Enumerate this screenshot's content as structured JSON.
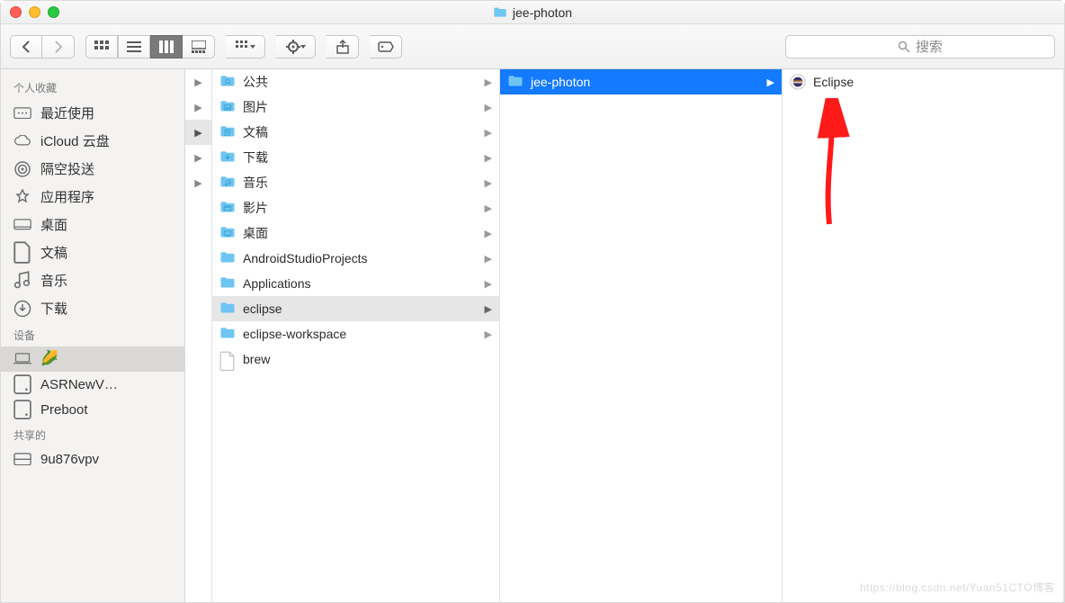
{
  "window": {
    "title": "jee-photon"
  },
  "search": {
    "placeholder": "搜索"
  },
  "sidebar": {
    "sections": [
      {
        "header": "个人收藏",
        "items": [
          {
            "label": "最近使用",
            "icon": "recents"
          },
          {
            "label": "iCloud 云盘",
            "icon": "cloud"
          },
          {
            "label": "隔空投送",
            "icon": "airdrop"
          },
          {
            "label": "应用程序",
            "icon": "apps"
          },
          {
            "label": "桌面",
            "icon": "desktop"
          },
          {
            "label": "文稿",
            "icon": "documents"
          },
          {
            "label": "音乐",
            "icon": "music"
          },
          {
            "label": "下载",
            "icon": "downloads"
          }
        ]
      },
      {
        "header": "设备",
        "items": [
          {
            "label": "🌽",
            "icon": "laptop",
            "selected": true,
            "emoji": true
          },
          {
            "label": "ASRNewV…",
            "icon": "disk"
          },
          {
            "label": "Preboot",
            "icon": "disk"
          }
        ]
      },
      {
        "header": "共享的",
        "items": [
          {
            "label": "9u876vpv",
            "icon": "server"
          }
        ]
      }
    ]
  },
  "column0": {
    "rows": [
      "",
      "",
      "sel",
      "",
      ""
    ]
  },
  "column1": {
    "items": [
      {
        "label": "公共",
        "type": "folder-public",
        "hasChildren": true
      },
      {
        "label": "图片",
        "type": "folder-pictures",
        "hasChildren": true
      },
      {
        "label": "文稿",
        "type": "folder-documents",
        "hasChildren": true
      },
      {
        "label": "下载",
        "type": "folder-downloads",
        "hasChildren": true
      },
      {
        "label": "音乐",
        "type": "folder-music",
        "hasChildren": true
      },
      {
        "label": "影片",
        "type": "folder-movies",
        "hasChildren": true
      },
      {
        "label": "桌面",
        "type": "folder-desktop",
        "hasChildren": true
      },
      {
        "label": "AndroidStudioProjects",
        "type": "folder",
        "hasChildren": true
      },
      {
        "label": "Applications",
        "type": "folder",
        "hasChildren": true
      },
      {
        "label": "eclipse",
        "type": "folder",
        "hasChildren": true,
        "selected": "grey"
      },
      {
        "label": "eclipse-workspace",
        "type": "folder",
        "hasChildren": true
      },
      {
        "label": "brew",
        "type": "file",
        "hasChildren": false
      }
    ]
  },
  "column2": {
    "items": [
      {
        "label": "jee-photon",
        "type": "folder",
        "hasChildren": true,
        "selected": "blue"
      }
    ]
  },
  "column3": {
    "items": [
      {
        "label": "Eclipse",
        "type": "eclipse-app",
        "hasChildren": false
      }
    ]
  },
  "watermark": "https://blog.csdn.net/Yuan51CTO博客"
}
